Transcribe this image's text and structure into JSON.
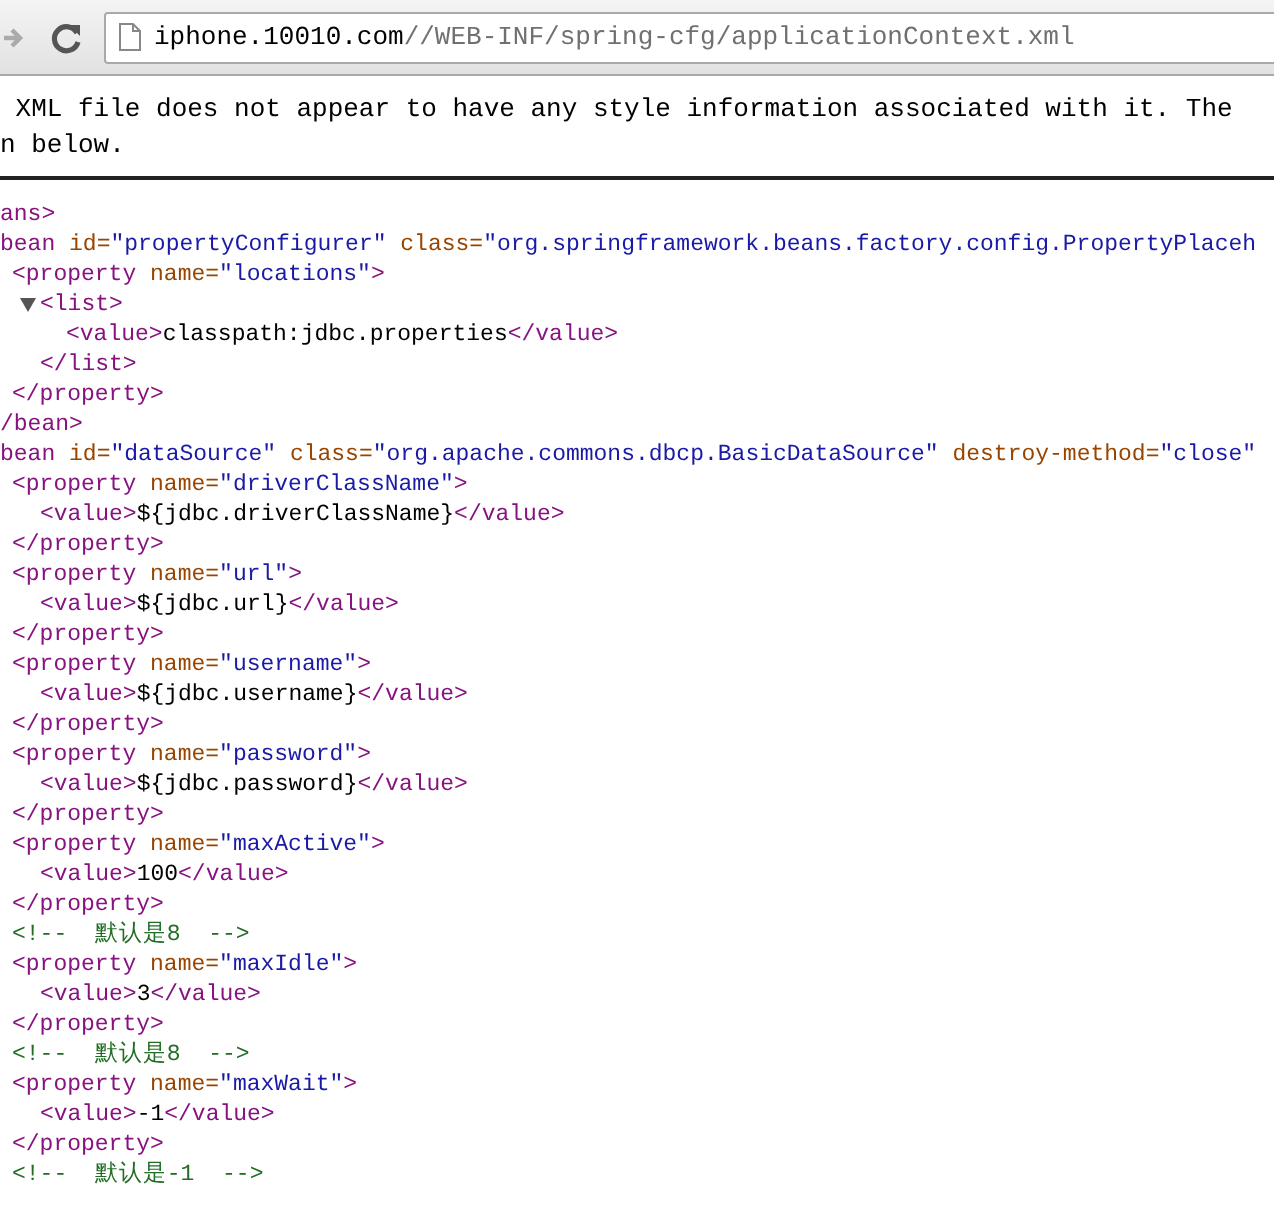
{
  "toolbar": {
    "address": {
      "host": "iphone.10010.com",
      "path": "//WEB-INF/spring-cfg/applicationContext.xml"
    }
  },
  "info_banner": {
    "lines": [
      " XML file does not appear to have any style information associated with it. The",
      "n below."
    ]
  },
  "xml_tree": [
    {
      "open": [
        {
          "kind": "tag",
          "text": "ans>"
        }
      ],
      "children": [
        {
          "open": [
            {
              "kind": "tag",
              "text": "bean"
            },
            {
              "kind": "attr",
              "text": " id="
            },
            {
              "kind": "val",
              "text": "\"propertyConfigurer\""
            },
            {
              "kind": "attr",
              "text": " class="
            },
            {
              "kind": "val",
              "text": "\"org.springframework.beans.factory.config.PropertyPlaceh"
            }
          ],
          "children": [
            {
              "open": [
                {
                  "kind": "tag",
                  "text": "<property"
                },
                {
                  "kind": "attr",
                  "text": " name="
                },
                {
                  "kind": "val",
                  "text": "\"locations\""
                },
                {
                  "kind": "tag",
                  "text": ">"
                }
              ],
              "children": [
                {
                  "open": [
                    {
                      "kind": "tag",
                      "text": "<list>"
                    }
                  ],
                  "expanded": true,
                  "children": [
                    {
                      "open": [
                        {
                          "kind": "tag",
                          "text": "<value>"
                        },
                        {
                          "kind": "text",
                          "text": "classpath:jdbc.properties"
                        },
                        {
                          "kind": "tag",
                          "text": "</value>"
                        }
                      ]
                    }
                  ],
                  "close": [
                    {
                      "kind": "tag",
                      "text": "</list>"
                    }
                  ]
                }
              ],
              "close": [
                {
                  "kind": "tag",
                  "text": "</property>"
                }
              ]
            }
          ],
          "close": [
            {
              "kind": "tag",
              "text": "/bean>"
            }
          ]
        },
        {
          "open": [
            {
              "kind": "tag",
              "text": "bean"
            },
            {
              "kind": "attr",
              "text": " id="
            },
            {
              "kind": "val",
              "text": "\"dataSource\""
            },
            {
              "kind": "attr",
              "text": " class="
            },
            {
              "kind": "val",
              "text": "\"org.apache.commons.dbcp.BasicDataSource\""
            },
            {
              "kind": "attr",
              "text": " destroy-method="
            },
            {
              "kind": "val",
              "text": "\"close\""
            }
          ],
          "children": [
            {
              "open": [
                {
                  "kind": "tag",
                  "text": "<property"
                },
                {
                  "kind": "attr",
                  "text": " name="
                },
                {
                  "kind": "val",
                  "text": "\"driverClassName\""
                },
                {
                  "kind": "tag",
                  "text": ">"
                }
              ],
              "children": [
                {
                  "open": [
                    {
                      "kind": "tag",
                      "text": "<value>"
                    },
                    {
                      "kind": "text",
                      "text": "${jdbc.driverClassName}"
                    },
                    {
                      "kind": "tag",
                      "text": "</value>"
                    }
                  ]
                }
              ],
              "close": [
                {
                  "kind": "tag",
                  "text": "</property>"
                }
              ]
            },
            {
              "open": [
                {
                  "kind": "tag",
                  "text": "<property"
                },
                {
                  "kind": "attr",
                  "text": " name="
                },
                {
                  "kind": "val",
                  "text": "\"url\""
                },
                {
                  "kind": "tag",
                  "text": ">"
                }
              ],
              "children": [
                {
                  "open": [
                    {
                      "kind": "tag",
                      "text": "<value>"
                    },
                    {
                      "kind": "text",
                      "text": "${jdbc.url}"
                    },
                    {
                      "kind": "tag",
                      "text": "</value>"
                    }
                  ]
                }
              ],
              "close": [
                {
                  "kind": "tag",
                  "text": "</property>"
                }
              ]
            },
            {
              "open": [
                {
                  "kind": "tag",
                  "text": "<property"
                },
                {
                  "kind": "attr",
                  "text": " name="
                },
                {
                  "kind": "val",
                  "text": "\"username\""
                },
                {
                  "kind": "tag",
                  "text": ">"
                }
              ],
              "children": [
                {
                  "open": [
                    {
                      "kind": "tag",
                      "text": "<value>"
                    },
                    {
                      "kind": "text",
                      "text": "${jdbc.username}"
                    },
                    {
                      "kind": "tag",
                      "text": "</value>"
                    }
                  ]
                }
              ],
              "close": [
                {
                  "kind": "tag",
                  "text": "</property>"
                }
              ]
            },
            {
              "open": [
                {
                  "kind": "tag",
                  "text": "<property"
                },
                {
                  "kind": "attr",
                  "text": " name="
                },
                {
                  "kind": "val",
                  "text": "\"password\""
                },
                {
                  "kind": "tag",
                  "text": ">"
                }
              ],
              "children": [
                {
                  "open": [
                    {
                      "kind": "tag",
                      "text": "<value>"
                    },
                    {
                      "kind": "text",
                      "text": "${jdbc.password}"
                    },
                    {
                      "kind": "tag",
                      "text": "</value>"
                    }
                  ]
                }
              ],
              "close": [
                {
                  "kind": "tag",
                  "text": "</property>"
                }
              ]
            },
            {
              "open": [
                {
                  "kind": "tag",
                  "text": "<property"
                },
                {
                  "kind": "attr",
                  "text": " name="
                },
                {
                  "kind": "val",
                  "text": "\"maxActive\""
                },
                {
                  "kind": "tag",
                  "text": ">"
                }
              ],
              "children": [
                {
                  "open": [
                    {
                      "kind": "tag",
                      "text": "<value>"
                    },
                    {
                      "kind": "text",
                      "text": "100"
                    },
                    {
                      "kind": "tag",
                      "text": "</value>"
                    }
                  ]
                }
              ],
              "close": [
                {
                  "kind": "tag",
                  "text": "</property>"
                }
              ]
            },
            {
              "open": [
                {
                  "kind": "comment",
                  "text": "<!--  默认是8  -->"
                }
              ]
            },
            {
              "open": [
                {
                  "kind": "tag",
                  "text": "<property"
                },
                {
                  "kind": "attr",
                  "text": " name="
                },
                {
                  "kind": "val",
                  "text": "\"maxIdle\""
                },
                {
                  "kind": "tag",
                  "text": ">"
                }
              ],
              "children": [
                {
                  "open": [
                    {
                      "kind": "tag",
                      "text": "<value>"
                    },
                    {
                      "kind": "text",
                      "text": "3"
                    },
                    {
                      "kind": "tag",
                      "text": "</value>"
                    }
                  ]
                }
              ],
              "close": [
                {
                  "kind": "tag",
                  "text": "</property>"
                }
              ]
            },
            {
              "open": [
                {
                  "kind": "comment",
                  "text": "<!--  默认是8  -->"
                }
              ]
            },
            {
              "open": [
                {
                  "kind": "tag",
                  "text": "<property"
                },
                {
                  "kind": "attr",
                  "text": " name="
                },
                {
                  "kind": "val",
                  "text": "\"maxWait\""
                },
                {
                  "kind": "tag",
                  "text": ">"
                }
              ],
              "children": [
                {
                  "open": [
                    {
                      "kind": "tag",
                      "text": "<value>"
                    },
                    {
                      "kind": "text",
                      "text": "-1"
                    },
                    {
                      "kind": "tag",
                      "text": "</value>"
                    }
                  ]
                }
              ],
              "close": [
                {
                  "kind": "tag",
                  "text": "</property>"
                }
              ]
            },
            {
              "open": [
                {
                  "kind": "comment",
                  "text": "<!--  默认是-1  -->"
                }
              ]
            }
          ]
        }
      ]
    }
  ]
}
